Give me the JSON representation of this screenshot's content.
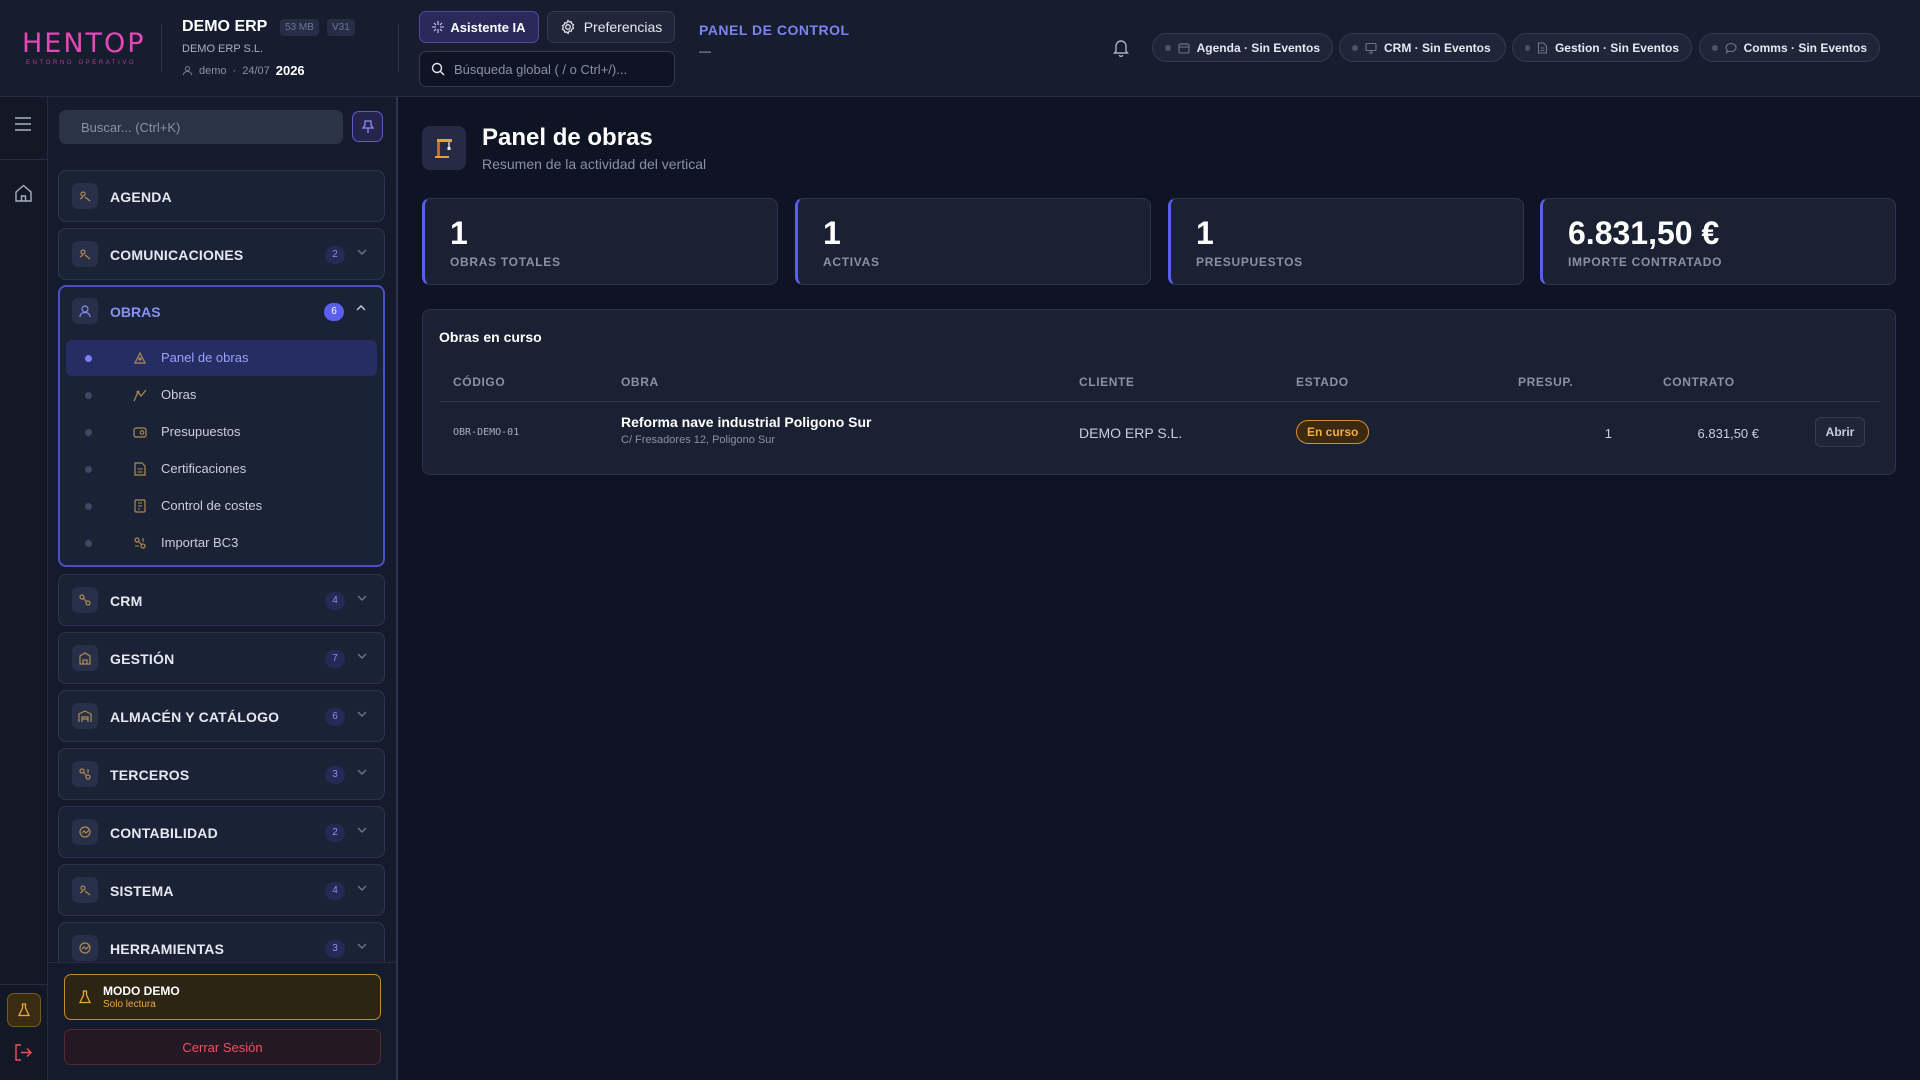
{
  "header": {
    "logo_text": "HENTOP",
    "logo_sub": "ENTORNO OPERATIVO",
    "app_name": "DEMO ERP",
    "storage": "53 MB",
    "version": "V31",
    "company": "DEMO ERP S.L.",
    "user": "demo",
    "date": "24/07",
    "year": "2026",
    "ai_button": "Asistente IA",
    "prefs_button": "Preferencias",
    "search_placeholder": "Búsqueda global ( / o Ctrl+/)...",
    "panel_title": "PANEL DE CONTROL",
    "panel_sub": "—",
    "status_pills": [
      {
        "label": "Agenda · Sin Eventos",
        "icon": "calendar-icon"
      },
      {
        "label": "CRM · Sin Eventos",
        "icon": "monitor-icon"
      },
      {
        "label": "Gestion · Sin Eventos",
        "icon": "document-icon"
      },
      {
        "label": "Comms · Sin Eventos",
        "icon": "chat-icon"
      }
    ]
  },
  "sidebar": {
    "search_placeholder": "Buscar... (Ctrl+K)",
    "sections": [
      {
        "label": "AGENDA",
        "count": ""
      },
      {
        "label": "COMUNICACIONES",
        "count": "2"
      },
      {
        "label": "OBRAS",
        "count": "6",
        "open": true
      },
      {
        "label": "CRM",
        "count": "4"
      },
      {
        "label": "GESTIÓN",
        "count": "7"
      },
      {
        "label": "ALMACÉN Y CATÁLOGO",
        "count": "6"
      },
      {
        "label": "TERCEROS",
        "count": "3"
      },
      {
        "label": "CONTABILIDAD",
        "count": "2"
      },
      {
        "label": "SISTEMA",
        "count": "4"
      },
      {
        "label": "HERRAMIENTAS",
        "count": "3"
      }
    ],
    "obras_items": [
      {
        "label": "Panel de obras",
        "active": true
      },
      {
        "label": "Obras"
      },
      {
        "label": "Presupuestos"
      },
      {
        "label": "Certificaciones"
      },
      {
        "label": "Control de costes"
      },
      {
        "label": "Importar BC3"
      }
    ],
    "demo_title": "MODO DEMO",
    "demo_sub": "Solo lectura",
    "logout": "Cerrar Sesión"
  },
  "main": {
    "title": "Panel de obras",
    "subtitle": "Resumen de la actividad del vertical",
    "kpis": [
      {
        "value": "1",
        "label": "OBRAS TOTALES"
      },
      {
        "value": "1",
        "label": "ACTIVAS"
      },
      {
        "value": "1",
        "label": "PRESUPUESTOS"
      },
      {
        "value": "6.831,50 €",
        "label": "IMPORTE CONTRATADO"
      }
    ],
    "table": {
      "title": "Obras en curso",
      "columns": [
        "CÓDIGO",
        "OBRA",
        "CLIENTE",
        "ESTADO",
        "PRESUP.",
        "CONTRATO"
      ],
      "rows": [
        {
          "code": "OBR-DEMO-01",
          "name": "Reforma nave industrial Poligono Sur",
          "address": "C/ Fresadores 12, Poligono Sur",
          "client": "DEMO ERP S.L.",
          "status": "En curso",
          "budgets": "1",
          "contract": "6.831,50 €",
          "action": "Abrir"
        }
      ]
    }
  },
  "colors": {
    "accent": "#5b5ff0",
    "brand_pink": "#e547b6",
    "warning": "#f6ad3b",
    "danger": "#f0505e"
  }
}
